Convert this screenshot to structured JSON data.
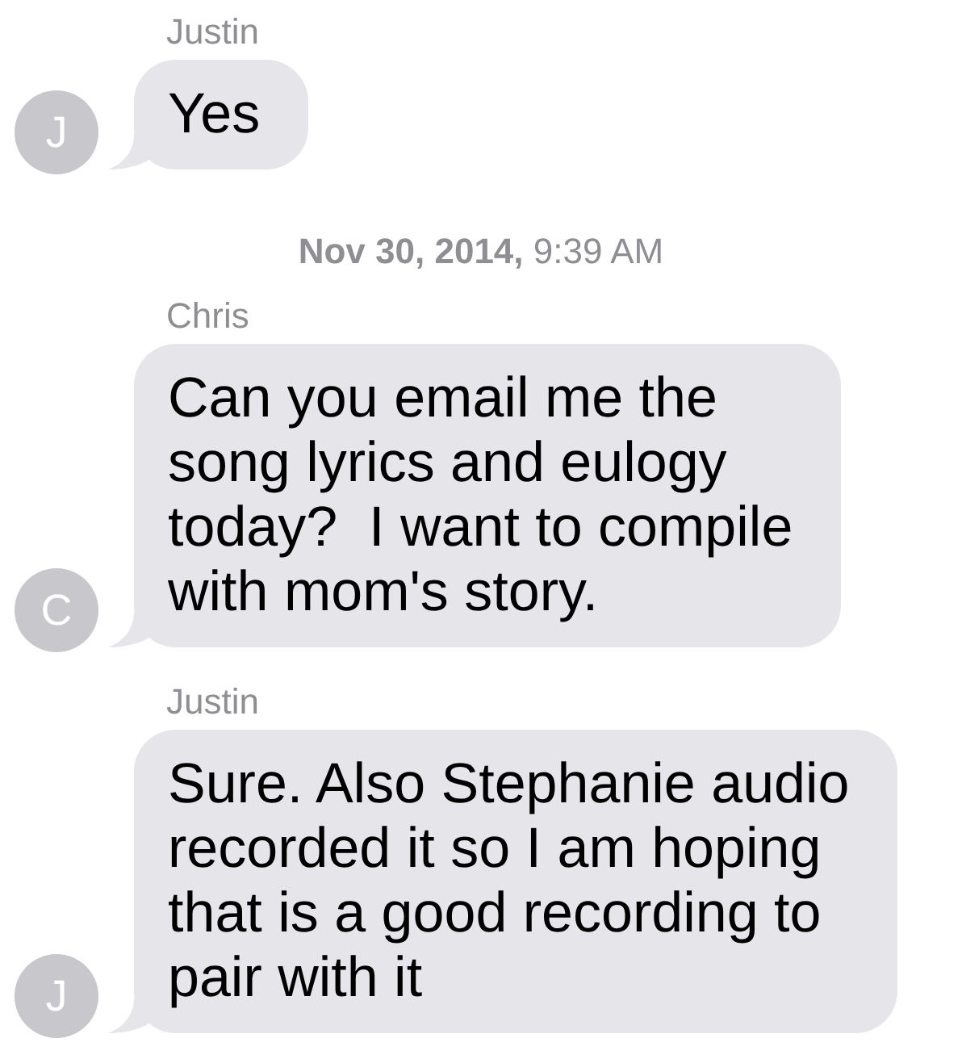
{
  "thread": [
    {
      "kind": "message",
      "sender": "Justin",
      "avatar": "J",
      "text": "Yes"
    },
    {
      "kind": "timestamp",
      "text": "**Nov 30, 2014,** 9:39 AM"
    },
    {
      "kind": "message",
      "sender": "Chris",
      "avatar": "C",
      "text": "Can you email me the\nsong lyrics and eulogy\ntoday?  I want to compile\nwith mom's story."
    },
    {
      "kind": "message",
      "sender": "Justin",
      "avatar": "J",
      "text": "Sure. Also Stephanie audio\nrecorded it so I am hoping\nthat is a good recording to\npair with it"
    }
  ]
}
